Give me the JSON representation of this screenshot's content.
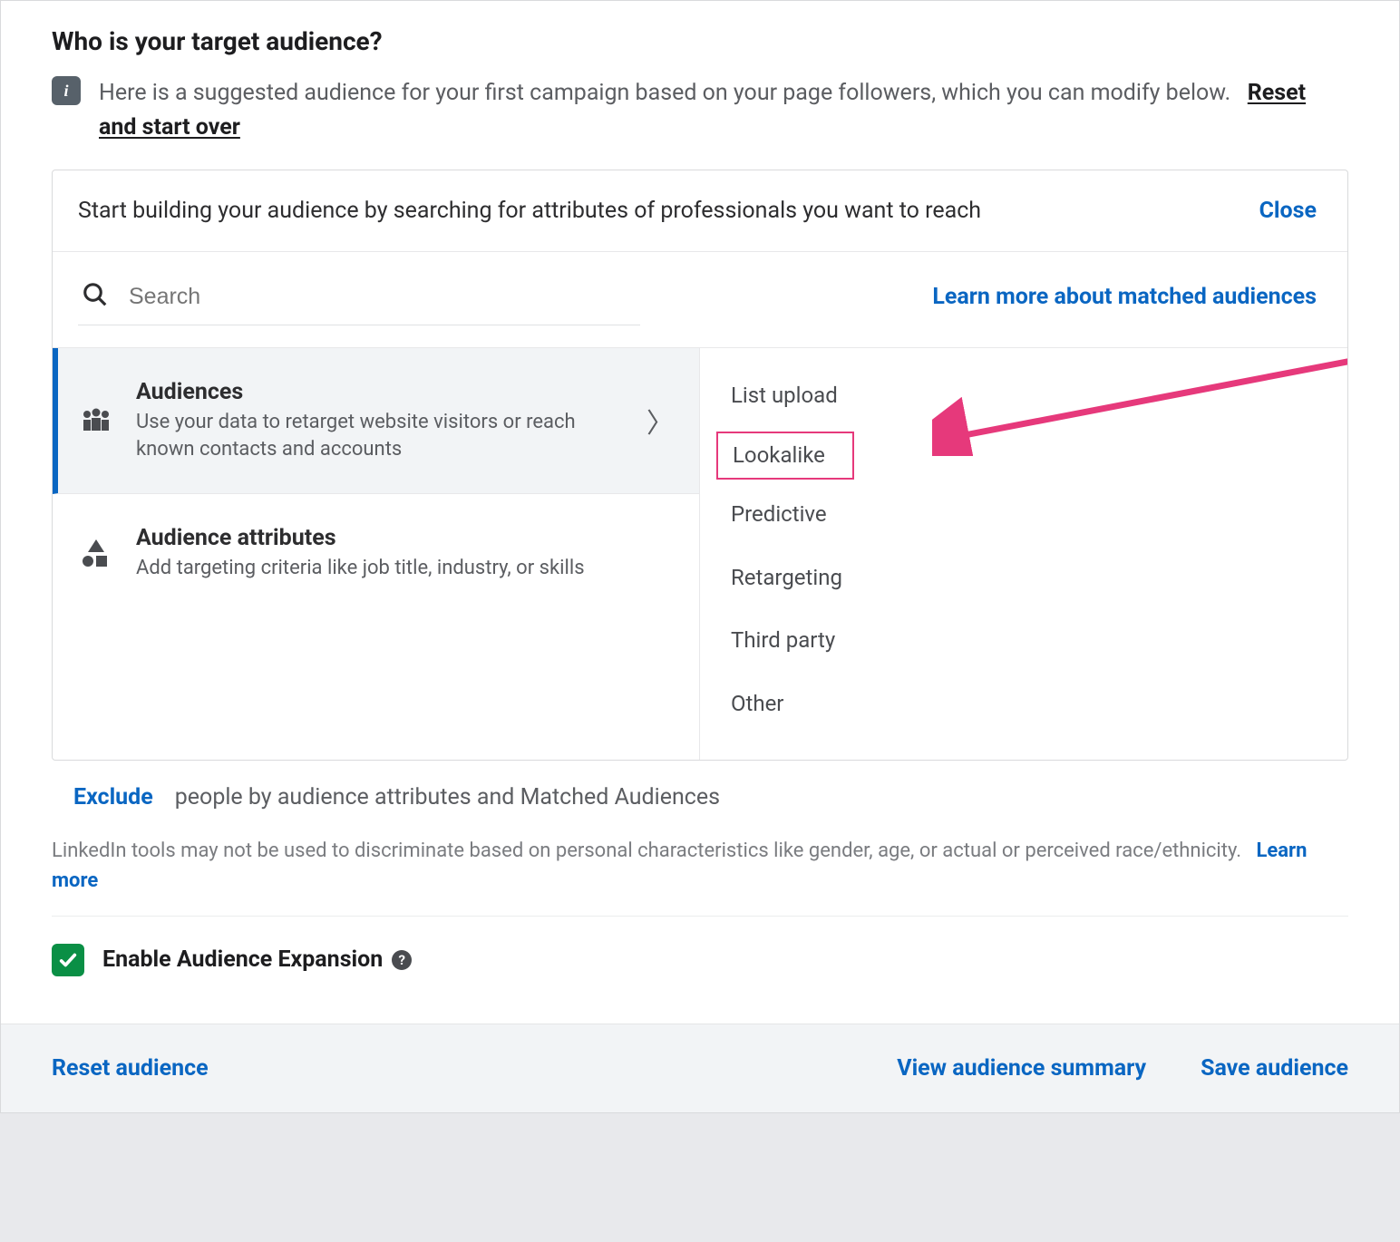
{
  "page": {
    "title": "Who is your target audience?",
    "info_text": "Here is a suggested audience for your first campaign based on your page followers, which you can modify below.",
    "reset_label": "Reset and start over"
  },
  "builder": {
    "header_text": "Start building your audience by searching for attributes of professionals you want to reach",
    "close_label": "Close",
    "search_placeholder": "Search",
    "learn_matched_label": "Learn more about matched audiences"
  },
  "left_items": {
    "audiences": {
      "title": "Audiences",
      "desc": "Use your data to retarget website visitors or reach known contacts and accounts"
    },
    "attributes": {
      "title": "Audience attributes",
      "desc": "Add targeting criteria like job title, industry, or skills"
    }
  },
  "right_items": {
    "list_upload": "List upload",
    "lookalike": "Lookalike",
    "predictive": "Predictive",
    "retargeting": "Retargeting",
    "third_party": "Third party",
    "other": "Other"
  },
  "exclude": {
    "link": "Exclude",
    "text": "people by audience attributes and Matched Audiences"
  },
  "disclaimer": {
    "text": "LinkedIn tools may not be used to discriminate based on personal characteristics like gender, age, or actual or perceived race/ethnicity.",
    "learn": "Learn more"
  },
  "expansion": {
    "label": "Enable Audience Expansion"
  },
  "footer": {
    "reset": "Reset audience",
    "view_summary": "View audience summary",
    "save": "Save audience"
  },
  "info_badge_glyph": "i"
}
